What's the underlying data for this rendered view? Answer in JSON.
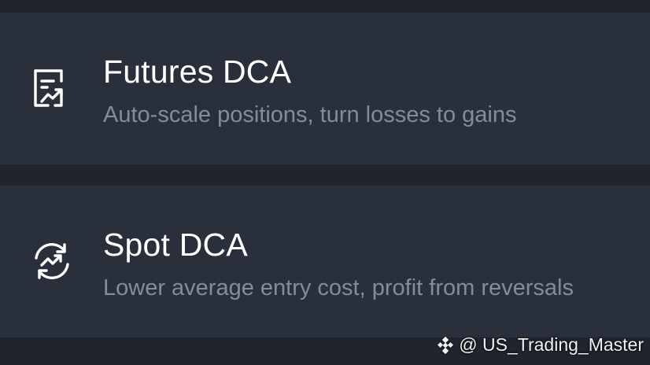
{
  "cards": [
    {
      "title": "Futures DCA",
      "subtitle": "Auto-scale positions, turn losses to gains",
      "icon": "document-chart-icon"
    },
    {
      "title": "Spot DCA",
      "subtitle": "Lower average entry cost, profit from reversals",
      "icon": "cycle-trend-icon"
    }
  ],
  "watermark": {
    "text": "@ US_Trading_Master",
    "icon": "binance-logo-icon"
  },
  "colors": {
    "background": "#1f242d",
    "card": "#2a303b",
    "title": "#ffffff",
    "subtitle": "#858b97"
  }
}
